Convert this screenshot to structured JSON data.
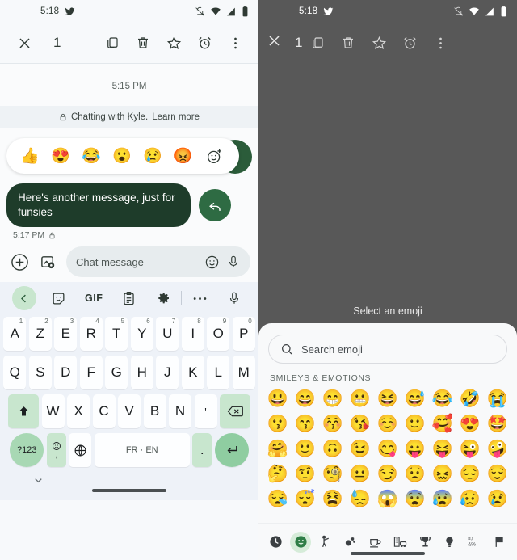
{
  "left": {
    "status": {
      "time": "5:18",
      "app_icon": "twitter-bird-icon",
      "indicators": [
        "notifications-off-icon",
        "wifi-icon",
        "signal-icon",
        "battery-icon"
      ]
    },
    "appbar": {
      "close_label": "close-icon",
      "selection_count": "1",
      "actions": [
        "copy-icon",
        "delete-icon",
        "star-icon",
        "alarm-icon",
        "overflow-menu-icon"
      ]
    },
    "chat": {
      "timestamp_divider": "5:15 PM",
      "encryption_notice": "Chatting with Kyle.",
      "encryption_link": "Learn more",
      "reactions": [
        "👍",
        "😍",
        "😂",
        "😮",
        "😢",
        "😡"
      ],
      "add_reaction_icon": "add-reaction-icon",
      "message_text": "Here's another message, just for funsies",
      "message_time": "5:17 PM",
      "message_lock_icon": "lock-icon",
      "reply_icon": "reply-icon"
    },
    "composer": {
      "plus_icon": "add-icon",
      "gallery_icon": "gallery-icon",
      "placeholder": "Chat message",
      "emoji_icon": "emoji-icon",
      "mic_icon": "microphone-icon"
    },
    "keyboard": {
      "toolbar": [
        "back-icon",
        "sticker-icon",
        "GIF",
        "clipboard-icon",
        "settings-gear-icon",
        "more-icon",
        "microphone-icon"
      ],
      "gif_label": "GIF",
      "row1": [
        {
          "key": "A",
          "sup": "1"
        },
        {
          "key": "Z",
          "sup": "2"
        },
        {
          "key": "E",
          "sup": "3"
        },
        {
          "key": "R",
          "sup": "4"
        },
        {
          "key": "T",
          "sup": "5"
        },
        {
          "key": "Y",
          "sup": "6"
        },
        {
          "key": "U",
          "sup": "7"
        },
        {
          "key": "I",
          "sup": "8"
        },
        {
          "key": "O",
          "sup": "9"
        },
        {
          "key": "P",
          "sup": "0"
        }
      ],
      "row2": [
        "Q",
        "S",
        "D",
        "F",
        "G",
        "H",
        "J",
        "K",
        "L",
        "M"
      ],
      "row3": [
        "W",
        "X",
        "C",
        "V",
        "B",
        "N",
        "'"
      ],
      "shift_icon": "shift-icon",
      "backspace_icon": "backspace-icon",
      "symbols_label": "?123",
      "emoji_key_icon": "emoji-icon",
      "comma_label": ",",
      "globe_icon": "language-globe-icon",
      "space_label": "FR · EN",
      "period_label": ".",
      "enter_icon": "enter-icon",
      "hide_keyboard_icon": "chevron-down-icon"
    }
  },
  "right": {
    "status": {
      "time": "5:18",
      "app_icon": "twitter-bird-icon"
    },
    "appbar": {
      "close_label": "close-icon",
      "selection_count": "1"
    },
    "sheet_title": "Select an emoji",
    "search": {
      "placeholder": "Search emoji",
      "icon": "search-icon"
    },
    "category_title": "SMILEYS & EMOTIONS",
    "emoji_rows": [
      [
        "😃",
        "😄",
        "😁",
        "😬",
        "😆",
        "😅",
        "😂",
        "🤣",
        "😭"
      ],
      [
        "😗",
        "😙",
        "😚",
        "😘",
        "☺️",
        "🙂",
        "🥰",
        "😍",
        "🤩"
      ],
      [
        "🤗",
        "🙂",
        "🙃",
        "😉",
        "😋",
        "😛",
        "😝",
        "😜",
        "🤪"
      ],
      [
        "🤔",
        "🤨",
        "🧐",
        "😐",
        "😏",
        "😟",
        "😖",
        "😔",
        "😌"
      ],
      [
        "😪",
        "😴",
        "😫",
        "😓",
        "😱",
        "😨",
        "😰",
        "😥",
        "😢"
      ]
    ],
    "categories": [
      {
        "name": "recent-icon",
        "active": false
      },
      {
        "name": "smileys-icon",
        "active": true
      },
      {
        "name": "people-icon",
        "active": false
      },
      {
        "name": "animals-nature-icon",
        "active": false
      },
      {
        "name": "food-drink-icon",
        "active": false
      },
      {
        "name": "travel-places-icon",
        "active": false
      },
      {
        "name": "activities-icon",
        "active": false
      },
      {
        "name": "objects-icon",
        "active": false
      },
      {
        "name": "symbols-icon",
        "active": false
      },
      {
        "name": "flags-icon",
        "active": false
      }
    ]
  },
  "colors": {
    "accent_green": "#2e6b43",
    "bubble_green": "#1e3c2a",
    "key_green": "#c8e6ce",
    "enter_green": "#8fcda1",
    "keyboard_bg": "#eef2f8",
    "scrim": "#585858"
  }
}
